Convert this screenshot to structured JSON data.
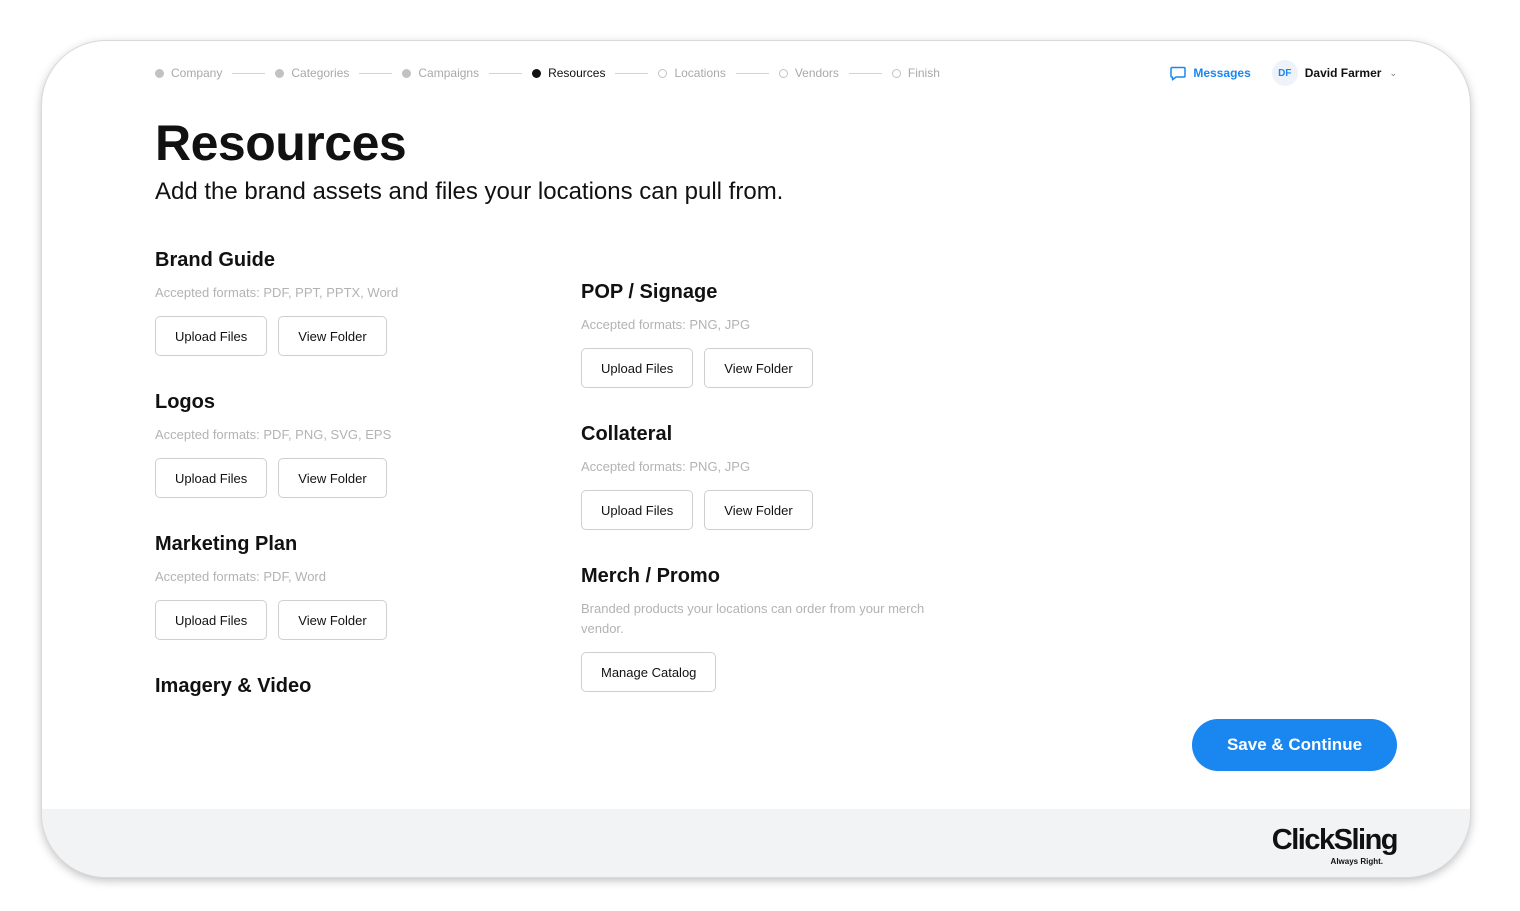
{
  "stepper": {
    "steps": [
      {
        "label": "Company",
        "state": "done"
      },
      {
        "label": "Categories",
        "state": "done"
      },
      {
        "label": "Campaigns",
        "state": "done"
      },
      {
        "label": "Resources",
        "state": "active"
      },
      {
        "label": "Locations",
        "state": "todo"
      },
      {
        "label": "Vendors",
        "state": "todo"
      },
      {
        "label": "Finish",
        "state": "todo"
      }
    ]
  },
  "header": {
    "messages_label": "Messages",
    "user_initials": "DF",
    "user_name": "David Farmer"
  },
  "page": {
    "title": "Resources",
    "subtitle": "Add the brand assets and files your locations can pull from."
  },
  "sections_left": [
    {
      "title": "Brand Guide",
      "desc": "Accepted formats: PDF, PPT, PPTX, Word",
      "buttons": [
        "Upload Files",
        "View Folder"
      ]
    },
    {
      "title": "Logos",
      "desc": "Accepted formats: PDF, PNG, SVG, EPS",
      "buttons": [
        "Upload Files",
        "View Folder"
      ]
    },
    {
      "title": "Marketing Plan",
      "desc": "Accepted formats: PDF, Word",
      "buttons": [
        "Upload Files",
        "View Folder"
      ]
    },
    {
      "title": "Imagery & Video"
    }
  ],
  "sections_right": [
    {
      "title": "POP / Signage",
      "desc": "Accepted formats: PNG, JPG",
      "buttons": [
        "Upload Files",
        "View Folder"
      ]
    },
    {
      "title": "Collateral",
      "desc": "Accepted formats: PNG, JPG",
      "buttons": [
        "Upload Files",
        "View Folder"
      ]
    },
    {
      "title": "Merch / Promo",
      "desc": "Branded products your locations can order from your merch vendor.",
      "buttons": [
        "Manage Catalog"
      ]
    }
  ],
  "actions": {
    "save_label": "Save & Continue"
  },
  "footer": {
    "logo_name": "ClickSling",
    "logo_tagline": "Always Right."
  },
  "colors": {
    "accent": "#1a86f0",
    "muted_text": "#b3b3b3",
    "footer_bg": "#f2f3f5"
  },
  "icons": {
    "messages": "chat-bubble-icon",
    "user_menu": "chevron-down-icon"
  }
}
